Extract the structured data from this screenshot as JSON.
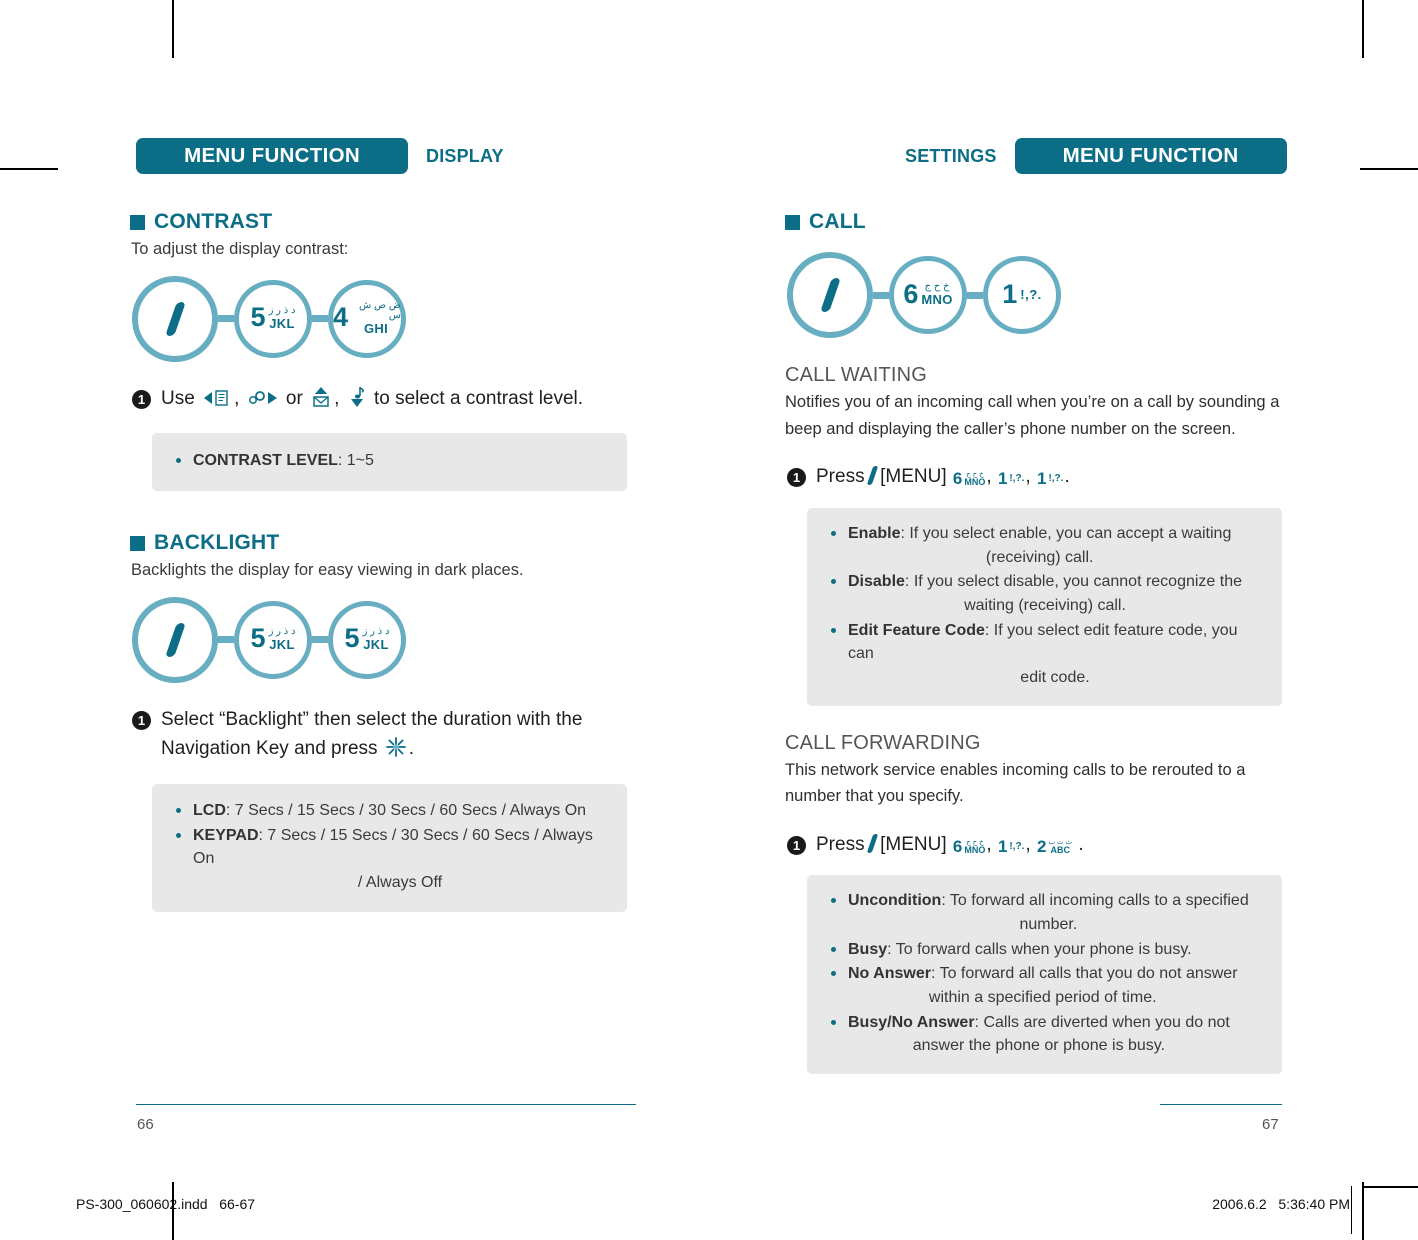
{
  "document": {
    "file_name": "PS-300_060602.indd",
    "spread_pages": "66-67",
    "timestamp_date": "2006.6.2",
    "timestamp_time": "5:36:40 PM"
  },
  "left_page": {
    "page_number": "66",
    "header": {
      "pill": "MENU FUNCTION",
      "sub": "DISPLAY"
    },
    "sections": [
      {
        "title": "CONTRAST",
        "desc": "To adjust the display contrast:",
        "keys": [
          {
            "type": "menu",
            "glyph": "slash-icon"
          },
          {
            "type": "key",
            "number": "5",
            "arabic": "د ذ ر ز",
            "latin": "JKL"
          },
          {
            "type": "key",
            "number": "4",
            "arabic": "ض ص ش س",
            "latin": "GHI"
          }
        ],
        "step": {
          "num": "1",
          "prefix": "Use",
          "mid": "or",
          "suffix": "to select a contrast level.",
          "icons": [
            "nav-left-icon",
            "nav-right-icon",
            "nav-up-icon",
            "nav-down-icon"
          ]
        },
        "note": [
          {
            "label": "CONTRAST LEVEL",
            "text": ": 1~5"
          }
        ]
      },
      {
        "title": "BACKLIGHT",
        "desc": "Backlights the display for easy viewing in dark places.",
        "keys": [
          {
            "type": "menu",
            "glyph": "slash-icon"
          },
          {
            "type": "key",
            "number": "5",
            "arabic": "د ذ ر ز",
            "latin": "JKL"
          },
          {
            "type": "key",
            "number": "5",
            "arabic": "د ذ ر ز",
            "latin": "JKL"
          }
        ],
        "step": {
          "num": "1",
          "line1": "Select “Backlight” then select the duration with the",
          "line2_prefix": "Navigation Key and press",
          "line2_suffix": ".",
          "icons": [
            "starburst-icon"
          ]
        },
        "note": [
          {
            "label": "LCD",
            "text": ": 7 Secs / 15 Secs / 30 Secs / 60 Secs / Always On"
          },
          {
            "label": "KEYPAD",
            "text": ": 7 Secs / 15 Secs / 30 Secs / 60 Secs / Always On",
            "cont": "/ Always Off"
          }
        ]
      }
    ]
  },
  "right_page": {
    "page_number": "67",
    "header": {
      "pill": "MENU FUNCTION",
      "sub": "SETTINGS"
    },
    "section": {
      "title": "CALL",
      "keys": [
        {
          "type": "menu",
          "glyph": "slash-icon"
        },
        {
          "type": "key",
          "number": "6",
          "arabic": "خ ح ج",
          "latin": "MNO"
        },
        {
          "type": "key",
          "number": "1",
          "punct": "!,?."
        }
      ]
    },
    "subsections": [
      {
        "title": "CALL WAITING",
        "body": "Notifies you of an incoming call when you’re on a call by sounding a beep and displaying the caller’s phone number on the screen.",
        "step": {
          "num": "1",
          "prefix": "Press",
          "menu_label": "[MENU]",
          "keys": [
            {
              "number": "6",
              "arabic": "خ ح ج",
              "latin": "MNO"
            },
            {
              "number": "1",
              "punct": "!,?."
            },
            {
              "number": "1",
              "punct": "!,?."
            }
          ],
          "terminator": "."
        },
        "note": [
          {
            "label": "Enable",
            "text": ": If you select enable, you can accept a waiting",
            "cont": "(receiving) call."
          },
          {
            "label": "Disable",
            "text": ": If you select disable, you cannot recognize the",
            "cont": "waiting (receiving) call."
          },
          {
            "label": "Edit Feature Code",
            "text": ": If you select edit feature code, you can",
            "cont": "edit code."
          }
        ]
      },
      {
        "title": "CALL FORWARDING",
        "body": "This network service enables incoming calls to be rerouted to a number that you specify.",
        "step": {
          "num": "1",
          "prefix": "Press",
          "menu_label": "[MENU]",
          "keys": [
            {
              "number": "6",
              "arabic": "خ ح ج",
              "latin": "MNO"
            },
            {
              "number": "1",
              "punct": "!,?."
            },
            {
              "number": "2",
              "arabic": "ث ت ب",
              "latin": "ABC"
            }
          ],
          "terminator": "."
        },
        "note": [
          {
            "label": "Uncondition",
            "text": ": To forward all incoming calls to a specified",
            "cont": "number."
          },
          {
            "label": "Busy",
            "text": ": To forward calls when your phone is busy."
          },
          {
            "label": "No Answer",
            "text": ": To forward all calls that you do not answer",
            "cont": "within a specified period of time."
          },
          {
            "label": "Busy/No Answer",
            "text": ": Calls are diverted when you do not",
            "cont": "answer the phone or phone is busy."
          }
        ]
      }
    ]
  },
  "colors": {
    "brand_dark": "#0b6e86",
    "brand_light": "#68aec2",
    "note_bg": "#e8e8e8"
  }
}
